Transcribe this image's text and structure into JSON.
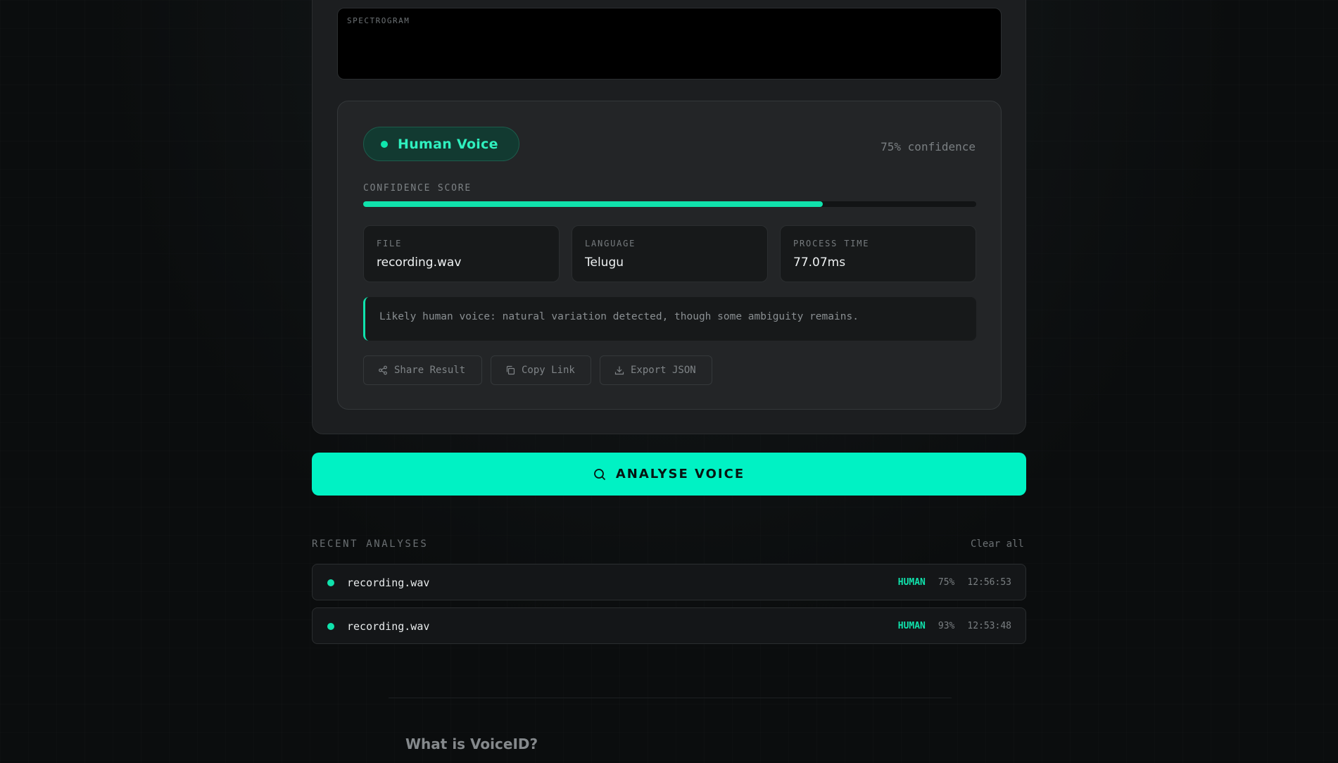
{
  "spectrogram": {
    "label": "SPECTROGRAM"
  },
  "result": {
    "verdict": "Human Voice",
    "confidence_text": "75% confidence",
    "score_label": "CONFIDENCE SCORE",
    "score_fraction": 0.75,
    "info": [
      {
        "label": "FILE",
        "value": "recording.wav"
      },
      {
        "label": "LANGUAGE",
        "value": "Telugu"
      },
      {
        "label": "PROCESS TIME",
        "value": "77.07ms"
      }
    ],
    "note": "Likely human voice: natural variation detected, though some ambiguity remains.",
    "actions": {
      "share": "Share Result",
      "copy": "Copy Link",
      "export": "Export JSON"
    }
  },
  "analyse_button": {
    "label": "ANALYSE VOICE"
  },
  "recent": {
    "heading": "RECENT ANALYSES",
    "clear_label": "Clear all",
    "items": [
      {
        "name": "recording.wav",
        "verdict": "HUMAN",
        "confidence": "75%",
        "time": "12:56:53"
      },
      {
        "name": "recording.wav",
        "verdict": "HUMAN",
        "confidence": "93%",
        "time": "12:53:48"
      }
    ]
  },
  "faq": {
    "title": "What is VoiceID?"
  },
  "colors": {
    "accent": "#00f2c4",
    "human": "#10e2ac",
    "background": "#0b0d0e",
    "card": "#232527"
  }
}
